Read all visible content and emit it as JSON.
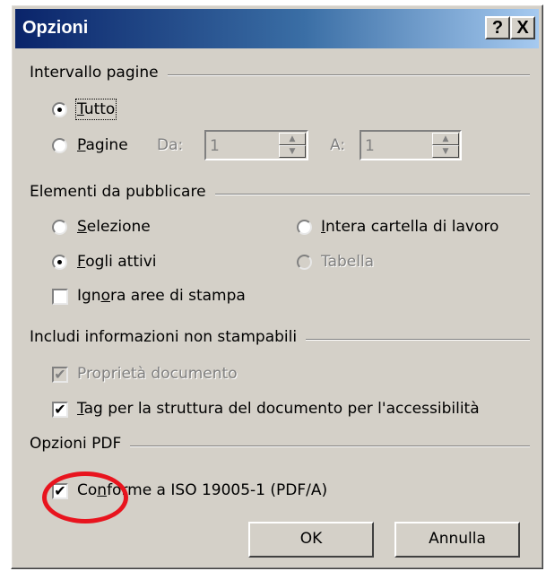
{
  "window": {
    "title": "Opzioni",
    "help_glyph": "?",
    "close_glyph": "X"
  },
  "page_range": {
    "group_label": "Intervallo pagine",
    "all": {
      "label": "Tutto",
      "checked": true
    },
    "pages": {
      "label": "Pagine",
      "checked": false
    },
    "from_label": "Da:",
    "from_value": "1",
    "to_label": "A:",
    "to_value": "1",
    "spin_up": "▲",
    "spin_down": "▼"
  },
  "publish": {
    "group_label": "Elementi da pubblicare",
    "selection": {
      "label": "Selezione",
      "checked": false
    },
    "entire_workbook": {
      "label": "Intera cartella di lavoro",
      "checked": false
    },
    "active_sheets": {
      "label": "Fogli attivi",
      "checked": true
    },
    "table": {
      "label": "Tabella",
      "checked": false,
      "disabled": true
    },
    "ignore_print_areas": {
      "label": "Ignora aree di stampa",
      "checked": false
    }
  },
  "non_printable": {
    "group_label": "Includi informazioni non stampabili",
    "document_properties": {
      "label": "Proprietà documento",
      "checked": true,
      "disabled": true
    },
    "accessibility_tags": {
      "label": "Tag per la struttura del documento per l'accessibilità",
      "checked": true
    }
  },
  "pdf_options": {
    "group_label": "Opzioni PDF",
    "iso_compliant": {
      "label": "Conforme a ISO 19005-1 (PDF/A)",
      "checked": true
    },
    "check_glyph": "✔"
  },
  "buttons": {
    "ok": "OK",
    "cancel": "Annulla"
  },
  "colors": {
    "title_bar": "#0a246a",
    "dialog_bg": "#d4d0c8",
    "annotation": "#e8141e"
  }
}
